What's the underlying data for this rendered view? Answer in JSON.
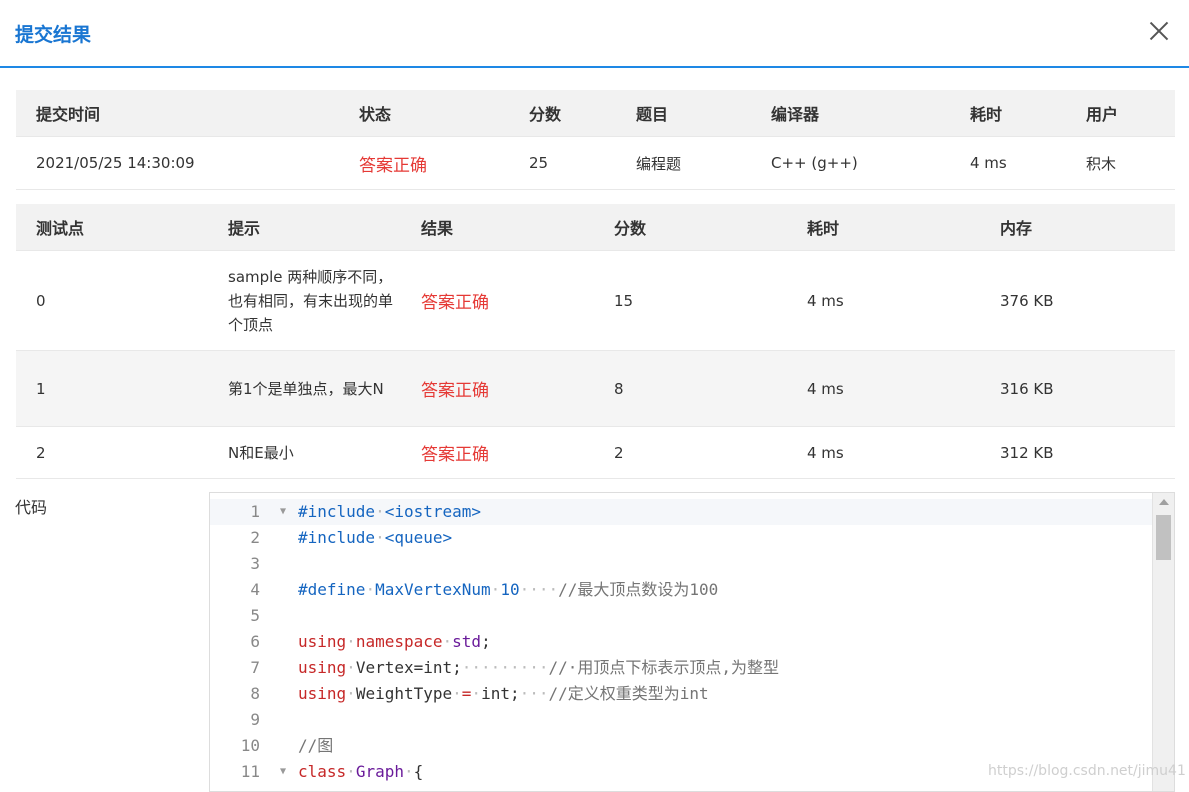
{
  "dialog": {
    "title": "提交结果"
  },
  "submission": {
    "headers": [
      "提交时间",
      "状态",
      "分数",
      "题目",
      "编译器",
      "耗时",
      "用户"
    ],
    "row": {
      "time": "2021/05/25 14:30:09",
      "status": "答案正确",
      "score": "25",
      "problem": "编程题",
      "compiler": "C++ (g++)",
      "elapsed": "4 ms",
      "user": "积木"
    }
  },
  "tests": {
    "headers": [
      "测试点",
      "提示",
      "结果",
      "分数",
      "耗时",
      "内存"
    ],
    "rows": [
      {
        "id": "0",
        "hint": "sample 两种顺序不同，也有相同，有末出现的单个顶点",
        "result": "答案正确",
        "score": "15",
        "time": "4 ms",
        "memory": "376 KB"
      },
      {
        "id": "1",
        "hint": "第1个是单独点，最大N",
        "result": "答案正确",
        "score": "8",
        "time": "4 ms",
        "memory": "316 KB"
      },
      {
        "id": "2",
        "hint": "N和E最小",
        "result": "答案正确",
        "score": "2",
        "time": "4 ms",
        "memory": "312 KB"
      }
    ]
  },
  "code": {
    "label": "代码",
    "lines": [
      {
        "num": "1",
        "fold": true,
        "tokens": [
          {
            "t": "#include",
            "c": "#1565c0"
          },
          {
            "t": "·",
            "c": "#bbb"
          },
          {
            "t": "<iostream>",
            "c": "#1565c0"
          }
        ]
      },
      {
        "num": "2",
        "fold": false,
        "tokens": [
          {
            "t": "#include",
            "c": "#1565c0"
          },
          {
            "t": "·",
            "c": "#bbb"
          },
          {
            "t": "<queue>",
            "c": "#1565c0"
          }
        ]
      },
      {
        "num": "3",
        "fold": false,
        "tokens": []
      },
      {
        "num": "4",
        "fold": false,
        "tokens": [
          {
            "t": "#define",
            "c": "#1565c0"
          },
          {
            "t": "·",
            "c": "#bbb"
          },
          {
            "t": "MaxVertexNum",
            "c": "#1565c0"
          },
          {
            "t": "·",
            "c": "#bbb"
          },
          {
            "t": "10",
            "c": "#1565c0"
          },
          {
            "t": "····",
            "c": "#bbb"
          },
          {
            "t": "//最大顶点数设为100",
            "c": "#757575"
          }
        ]
      },
      {
        "num": "5",
        "fold": false,
        "tokens": []
      },
      {
        "num": "6",
        "fold": false,
        "tokens": [
          {
            "t": "using",
            "c": "#c62828"
          },
          {
            "t": "·",
            "c": "#bbb"
          },
          {
            "t": "namespace",
            "c": "#c62828"
          },
          {
            "t": "·",
            "c": "#bbb"
          },
          {
            "t": "std",
            "c": "#6a1b9a"
          },
          {
            "t": ";",
            "c": "#333"
          }
        ]
      },
      {
        "num": "7",
        "fold": false,
        "tokens": [
          {
            "t": "using",
            "c": "#c62828"
          },
          {
            "t": "·",
            "c": "#bbb"
          },
          {
            "t": "Vertex=int;",
            "c": "#333"
          },
          {
            "t": "·········",
            "c": "#bbb"
          },
          {
            "t": "//·用顶点下标表示顶点,为整型",
            "c": "#757575"
          }
        ]
      },
      {
        "num": "8",
        "fold": false,
        "tokens": [
          {
            "t": "using",
            "c": "#c62828"
          },
          {
            "t": "·",
            "c": "#bbb"
          },
          {
            "t": "WeightType",
            "c": "#333"
          },
          {
            "t": "·",
            "c": "#bbb"
          },
          {
            "t": "=",
            "c": "#c62828"
          },
          {
            "t": "·",
            "c": "#bbb"
          },
          {
            "t": "int;",
            "c": "#333"
          },
          {
            "t": "···",
            "c": "#bbb"
          },
          {
            "t": "//定义权重类型为int",
            "c": "#757575"
          }
        ]
      },
      {
        "num": "9",
        "fold": false,
        "tokens": []
      },
      {
        "num": "10",
        "fold": false,
        "tokens": [
          {
            "t": "//图",
            "c": "#757575"
          }
        ]
      },
      {
        "num": "11",
        "fold": true,
        "tokens": [
          {
            "t": "class",
            "c": "#c62828"
          },
          {
            "t": "·",
            "c": "#bbb"
          },
          {
            "t": "Graph",
            "c": "#6a1b9a"
          },
          {
            "t": "·",
            "c": "#bbb"
          },
          {
            "t": "{",
            "c": "#333"
          }
        ]
      }
    ]
  },
  "watermark": "https://blog.csdn.net/jimu41"
}
